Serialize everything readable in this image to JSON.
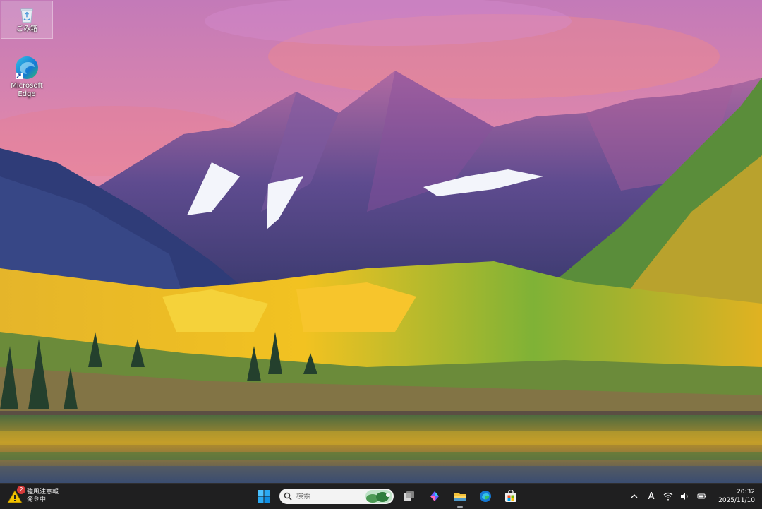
{
  "desktop": {
    "icons": [
      {
        "label": "ごみ箱",
        "icon": "recycle-bin-icon"
      },
      {
        "label": "Microsoft Edge",
        "icon": "edge-icon"
      }
    ]
  },
  "taskbar": {
    "weather": {
      "badge_count": "2",
      "title": "強風注意報",
      "subtitle": "発令中",
      "icon": "warning-icon"
    },
    "search": {
      "placeholder": "検索"
    },
    "apps": [
      {
        "name": "Start",
        "icon": "windows-start-icon"
      },
      {
        "name": "Task View",
        "icon": "task-view-icon"
      },
      {
        "name": "Copilot",
        "icon": "copilot-icon"
      },
      {
        "name": "File Explorer",
        "icon": "file-explorer-icon"
      },
      {
        "name": "Microsoft Edge",
        "icon": "edge-icon"
      },
      {
        "name": "Microsoft Store",
        "icon": "store-icon"
      }
    ],
    "tray": {
      "ime_label": "A",
      "time": "20:32",
      "date": "2025/11/10"
    }
  },
  "colors": {
    "taskbar_bg": "#1f1f20",
    "accent": "#0078d4",
    "warning": "#f2c200"
  }
}
